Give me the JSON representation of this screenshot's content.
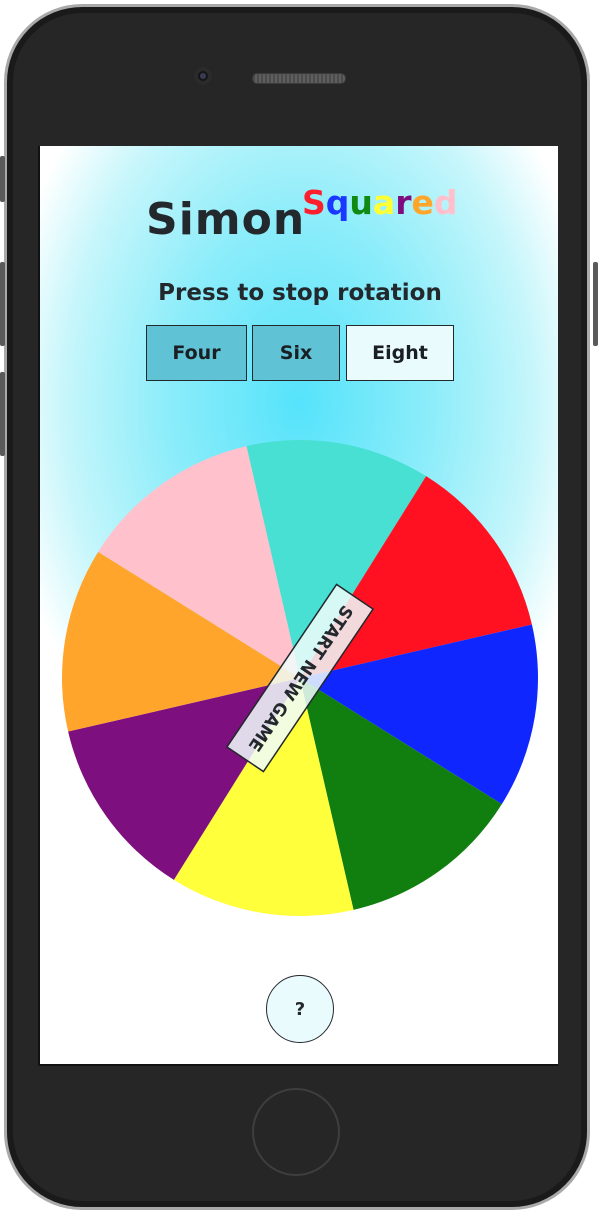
{
  "app": {
    "title_main": "Simon",
    "title_sup_letters": [
      {
        "char": "S",
        "color": "#ff1e2d"
      },
      {
        "char": "q",
        "color": "#1a38ff"
      },
      {
        "char": "u",
        "color": "#118a11"
      },
      {
        "char": "a",
        "color": "#ffff33"
      },
      {
        "char": "r",
        "color": "#7e0e7e"
      },
      {
        "char": "e",
        "color": "#ffa52a"
      },
      {
        "char": "d",
        "color": "#ffc0cb"
      }
    ]
  },
  "instructions": "Press to stop rotation",
  "modes": [
    {
      "label": "Four",
      "selected": false
    },
    {
      "label": "Six",
      "selected": false
    },
    {
      "label": "Eight",
      "selected": true
    }
  ],
  "wheel": {
    "segments": [
      {
        "color": "turquoise",
        "hex": "#48e0d2"
      },
      {
        "color": "red",
        "hex": "#ff1122"
      },
      {
        "color": "blue",
        "hex": "#0f26ff"
      },
      {
        "color": "green",
        "hex": "#107f10"
      },
      {
        "color": "yellow",
        "hex": "#ffff3b"
      },
      {
        "color": "purple",
        "hex": "#7e0f7e"
      },
      {
        "color": "orange",
        "hex": "#ffa52c"
      },
      {
        "color": "pink",
        "hex": "#ffc1cc"
      }
    ],
    "rotation_deg": -13,
    "start_label": "START NEW GAME"
  },
  "help": {
    "label": "?"
  }
}
